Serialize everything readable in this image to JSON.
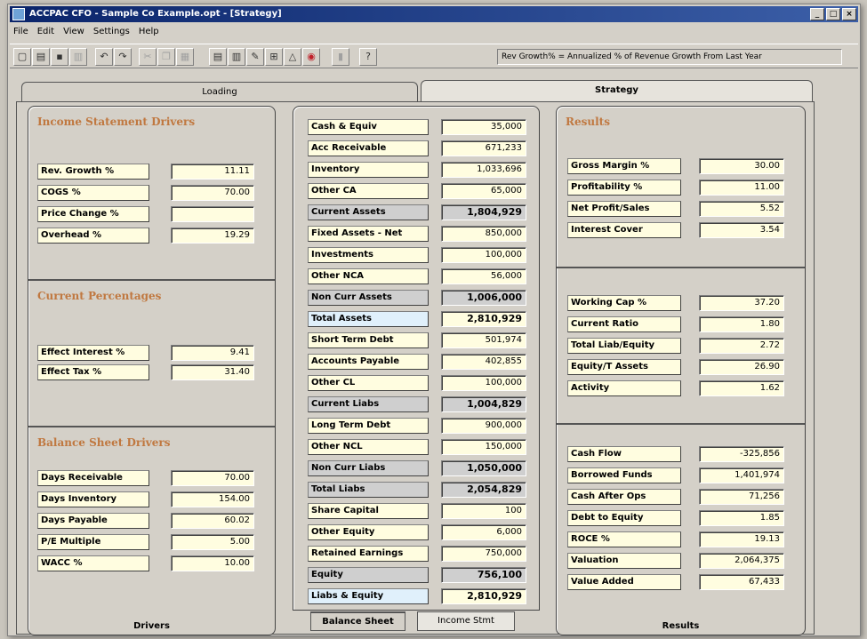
{
  "window": {
    "title": "ACCPAC CFO - Sample Co Example.opt - [Strategy]",
    "controls": [
      "_",
      "□",
      "×"
    ]
  },
  "menu": [
    "File",
    "Edit",
    "View",
    "Settings",
    "Help"
  ],
  "toolbar": {
    "hint": "Rev Growth% = Annualized % of Revenue Growth From Last Year",
    "icons": [
      "new-icon",
      "open-icon",
      "save-icon",
      "print-icon",
      "undo-icon",
      "redo-icon",
      "cut-icon",
      "copy-icon",
      "paste-icon",
      "report-icon",
      "chart-icon",
      "wizard-icon",
      "tree-icon",
      "triangle-icon",
      "target-icon",
      "bar-icon",
      "help-icon"
    ]
  },
  "tabs": {
    "loading": "Loading",
    "strategy": "Strategy"
  },
  "drivers": {
    "income_title": "Income Statement Drivers",
    "income": [
      {
        "label": "Rev. Growth %",
        "value": "11.11"
      },
      {
        "label": "COGS %",
        "value": "70.00"
      },
      {
        "label": "Price Change %",
        "value": ""
      },
      {
        "label": "Overhead %",
        "value": "19.29"
      }
    ],
    "current_title": "Current Percentages",
    "current": [
      {
        "label": "Effect Interest %",
        "value": "9.41"
      },
      {
        "label": "Effect Tax %",
        "value": "31.40"
      }
    ],
    "balance_title": "Balance Sheet Drivers",
    "balance": [
      {
        "label": "Days Receivable",
        "value": "70.00"
      },
      {
        "label": "Days Inventory",
        "value": "154.00"
      },
      {
        "label": "Days Payable",
        "value": "60.02"
      },
      {
        "label": "P/E Multiple",
        "value": "5.00"
      },
      {
        "label": "WACC %",
        "value": "10.00"
      }
    ],
    "footer": "Drivers"
  },
  "balance_sheet": {
    "rows": [
      {
        "label": "Cash & Equiv",
        "value": "35,000"
      },
      {
        "label": "Acc Receivable",
        "value": "671,233"
      },
      {
        "label": "Inventory",
        "value": "1,033,696"
      },
      {
        "label": "Other CA",
        "value": "65,000"
      },
      {
        "label": "Current Assets",
        "value": "1,804,929"
      },
      {
        "label": "Fixed Assets - Net",
        "value": "850,000"
      },
      {
        "label": "Investments",
        "value": "100,000"
      },
      {
        "label": "Other NCA",
        "value": "56,000"
      },
      {
        "label": "Non Curr Assets",
        "value": "1,006,000"
      },
      {
        "label": "Total Assets",
        "value": "2,810,929"
      },
      {
        "label": "Short Term Debt",
        "value": "501,974"
      },
      {
        "label": "Accounts Payable",
        "value": "402,855"
      },
      {
        "label": "Other CL",
        "value": "100,000"
      },
      {
        "label": "Current Liabs",
        "value": "1,004,829"
      },
      {
        "label": "Long Term Debt",
        "value": "900,000"
      },
      {
        "label": "Other NCL",
        "value": "150,000"
      },
      {
        "label": "Non Curr Liabs",
        "value": "1,050,000"
      },
      {
        "label": "Total Liabs",
        "value": "2,054,829"
      },
      {
        "label": "Share Capital",
        "value": "100"
      },
      {
        "label": "Other Equity",
        "value": "6,000"
      },
      {
        "label": "Retained Earnings",
        "value": "750,000"
      },
      {
        "label": "Equity",
        "value": "756,100"
      },
      {
        "label": "Liabs & Equity",
        "value": "2,810,929"
      }
    ],
    "tab_active": "Balance Sheet",
    "tab_inactive": "Income Stmt"
  },
  "results": {
    "title": "Results",
    "group1": [
      {
        "label": "Gross Margin %",
        "value": "30.00"
      },
      {
        "label": "Profitability %",
        "value": "11.00"
      },
      {
        "label": "Net Profit/Sales",
        "value": "5.52"
      },
      {
        "label": "Interest Cover",
        "value": "3.54"
      }
    ],
    "group2": [
      {
        "label": "Working Cap %",
        "value": "37.20"
      },
      {
        "label": "Current Ratio",
        "value": "1.80"
      },
      {
        "label": "Total Liab/Equity",
        "value": "2.72"
      },
      {
        "label": "Equity/T Assets",
        "value": "26.90"
      },
      {
        "label": "Activity",
        "value": "1.62"
      }
    ],
    "group3": [
      {
        "label": "Cash Flow",
        "value": "-325,856"
      },
      {
        "label": "Borrowed Funds",
        "value": "1,401,974"
      },
      {
        "label": "Cash After Ops",
        "value": "71,256"
      },
      {
        "label": "Debt to Equity",
        "value": "1.85"
      },
      {
        "label": "ROCE %",
        "value": "19.13"
      },
      {
        "label": "Valuation",
        "value": "2,064,375"
      },
      {
        "label": "Value Added",
        "value": "67,433"
      }
    ],
    "footer": "Results"
  }
}
